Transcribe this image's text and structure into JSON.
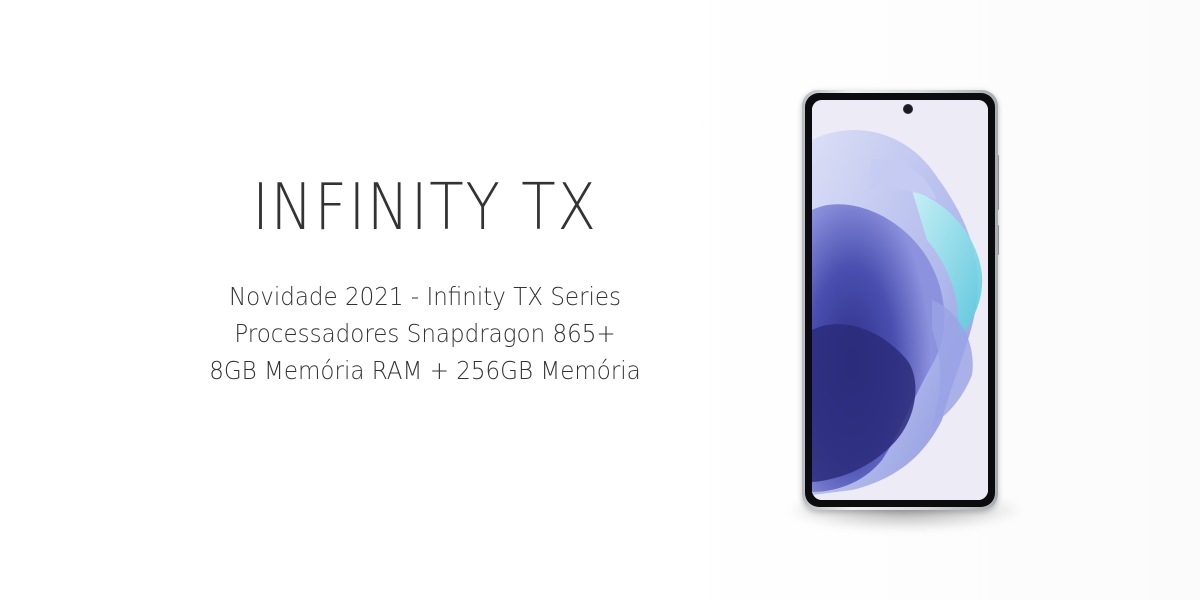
{
  "banner": {
    "title": "INFINITY TX",
    "lines": [
      "Novidade 2021 - Infinity TX Series",
      "Processadores Snapdragon 865+",
      "8GB Memória RAM + 256GB Memória"
    ]
  },
  "product_image": {
    "icon": "smartphone-icon",
    "colors": {
      "screen_bg": "#ecebf6",
      "wallpaper_deep": "#3b3b8f",
      "wallpaper_mid": "#7f7fd6",
      "wallpaper_light": "#bfc8f2",
      "wallpaper_cyan": "#7fe0e8",
      "frame": "#d9dbdf"
    }
  }
}
